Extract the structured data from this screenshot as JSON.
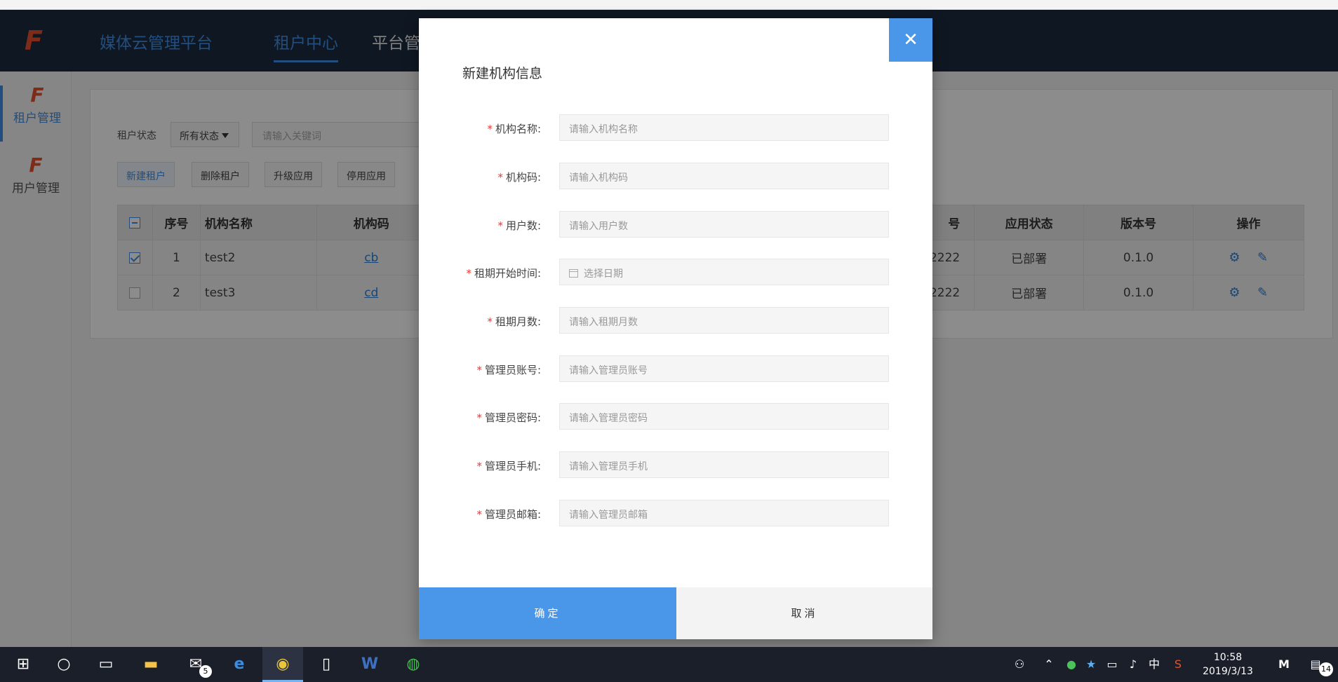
{
  "header": {
    "logo": "F",
    "platform_title": "媒体云管理平台",
    "tabs": [
      {
        "label": "租户中心",
        "active": true
      },
      {
        "label": "平台管"
      }
    ]
  },
  "sidebar": {
    "items": [
      {
        "label": "租户管理",
        "active": true
      },
      {
        "label": "用户管理",
        "active": false
      }
    ]
  },
  "filters": {
    "status_label": "租户状态",
    "status_value": "所有状态",
    "keyword_placeholder": "请输入关键词"
  },
  "toolbar": {
    "buttons": [
      "新建租户",
      "删除租户",
      "升级应用",
      "停用应用"
    ]
  },
  "table": {
    "columns": [
      "序号",
      "机构名称",
      "机构码",
      "号",
      "应用状态",
      "版本号",
      "操作"
    ],
    "rows": [
      {
        "checked": true,
        "index": "1",
        "name": "test2",
        "code": "cb",
        "num": "2222",
        "status": "已部署",
        "version": "0.1.0"
      },
      {
        "checked": false,
        "index": "2",
        "name": "test3",
        "code": "cd",
        "num": "2222",
        "status": "已部署",
        "version": "0.1.0"
      }
    ]
  },
  "modal": {
    "title": "新建机构信息",
    "close_icon": "close-icon",
    "fields": [
      {
        "label": "机构名称:",
        "placeholder": "请输入机构名称"
      },
      {
        "label": "机构码:",
        "placeholder": "请输入机构码"
      },
      {
        "label": "用户数:",
        "placeholder": "请输入用户数"
      },
      {
        "label": "租期开始时间:",
        "placeholder": "选择日期"
      },
      {
        "label": "租期月数:",
        "placeholder": "请输入租期月数"
      },
      {
        "label": "管理员账号:",
        "placeholder": "请输入管理员账号"
      },
      {
        "label": "管理员密码:",
        "placeholder": "请输入管理员密码"
      },
      {
        "label": "管理员手机:",
        "placeholder": "请输入管理员手机"
      },
      {
        "label": "管理员邮箱:",
        "placeholder": "请输入管理员邮箱"
      }
    ],
    "required_mark": "*",
    "ok_label": "确定",
    "cancel_label": "取消"
  },
  "taskbar": {
    "mail_badge": "5",
    "ime": "中",
    "time": "10:58",
    "date": "2019/3/13",
    "notification_count": "14"
  },
  "colors": {
    "accent": "#4a97e9",
    "header_bg": "#1c2b3f",
    "logo": "#e6502a",
    "required": "#e53935"
  }
}
